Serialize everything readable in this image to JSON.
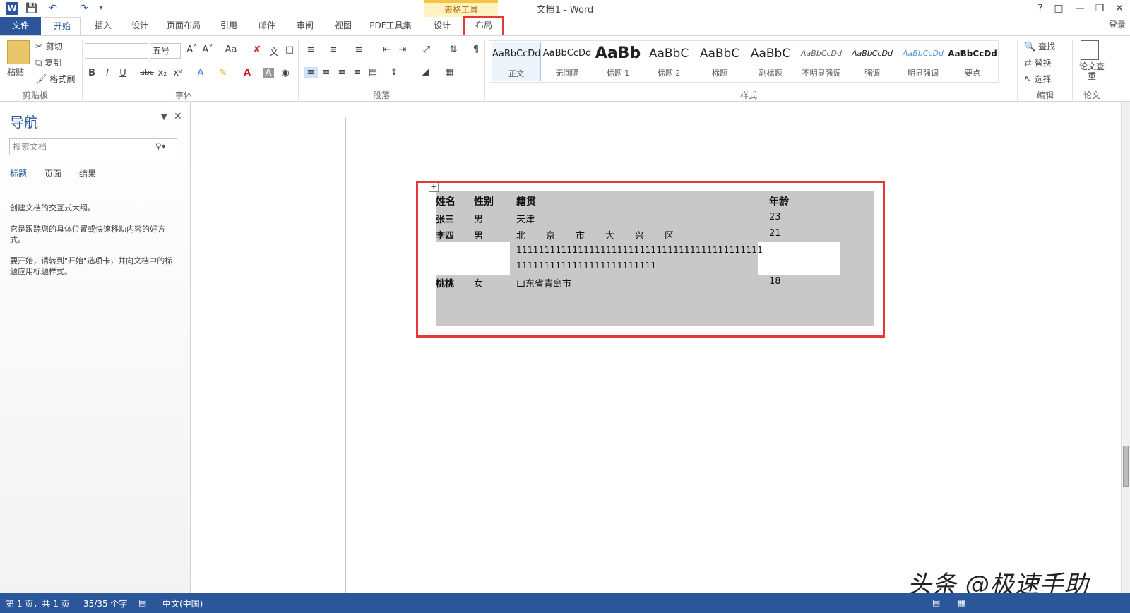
{
  "app": {
    "title": "文档1 - Word",
    "table_tools": "表格工具",
    "login": "登录"
  },
  "tabs": [
    "文件",
    "开始",
    "插入",
    "设计",
    "页面布局",
    "引用",
    "邮件",
    "审阅",
    "视图",
    "PDF工具集",
    "设计",
    "布局"
  ],
  "ribbon": {
    "clipboard": {
      "paste": "粘贴",
      "cut": "剪切",
      "copy": "复制",
      "format_painter": "格式刷",
      "label": "剪贴板"
    },
    "font": {
      "font_name": "",
      "font_size": "五号",
      "label": "字体",
      "change_case": "Aa"
    },
    "paragraph": {
      "label": "段落"
    },
    "styles": {
      "label": "样式",
      "items": [
        {
          "sample": "AaBbCcDd",
          "name": "正文"
        },
        {
          "sample": "AaBbCcDd",
          "name": "无间隔"
        },
        {
          "sample": "AaBb",
          "name": "标题 1"
        },
        {
          "sample": "AaBbC",
          "name": "标题 2"
        },
        {
          "sample": "AaBbC",
          "name": "标题"
        },
        {
          "sample": "AaBbC",
          "name": "副标题"
        },
        {
          "sample": "AaBbCcDd",
          "name": "不明显强调"
        },
        {
          "sample": "AaBbCcDd",
          "name": "强调"
        },
        {
          "sample": "AaBbCcDd",
          "name": "明显强调"
        },
        {
          "sample": "AaBbCcDd",
          "name": "要点"
        }
      ]
    },
    "editing": {
      "find": "查找",
      "replace": "替换",
      "select": "选择",
      "label": "编辑"
    },
    "paper": {
      "check": "论文查重",
      "label": "论文"
    }
  },
  "nav": {
    "title": "导航",
    "search_placeholder": "搜索文档",
    "tabs": [
      "标题",
      "页面",
      "结果"
    ],
    "text1": "创建文档的交互式大纲。",
    "text2": "它是跟踪您的具体位置或快速移动内容的好方式。",
    "text3": "要开始，请转到\"开始\"选项卡，并向文档中的标题应用标题样式。"
  },
  "table": {
    "headers": [
      "姓名",
      "性别",
      "籍贯",
      "年龄"
    ],
    "rows": [
      [
        "张三",
        "男",
        "天津",
        "23"
      ],
      [
        "李四",
        "男",
        "北　　京　　市　　大　　兴　　区",
        "21"
      ],
      [
        "",
        "",
        "11111111111111111111111111111111111111111111",
        ""
      ],
      [
        "",
        "",
        "1111111111111111111111111",
        ""
      ],
      [
        "桃桃",
        "女",
        "山东省青岛市",
        "18"
      ]
    ]
  },
  "status": {
    "page": "第 1 页，共 1 页",
    "words": "35/35 个字",
    "lang": "中文(中国)"
  },
  "watermark": "头条 @极速手助"
}
